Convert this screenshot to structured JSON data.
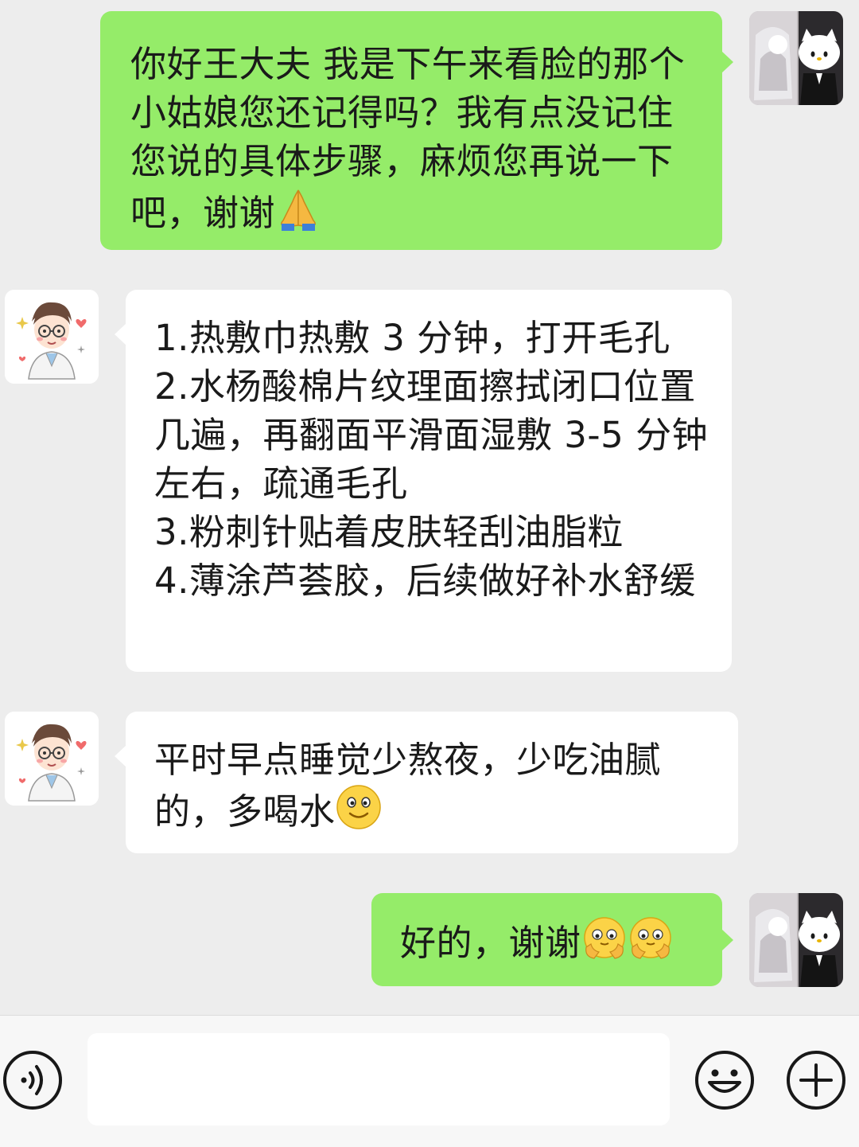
{
  "messages": [
    {
      "sender": "me",
      "text": "你好王大夫 我是下午来看脸的那个小姑娘您还记得吗？我有点没记住您说的具体步骤，麻烦您再说一下吧，谢谢",
      "emoji": "folded-hands"
    },
    {
      "sender": "doctor",
      "text": "1.热敷巾热敷 3 分钟，打开毛孔\n2.水杨酸棉片纹理面擦拭闭口位置几遍，再翻面平滑面湿敷 3-5 分钟左右，疏通毛孔\n3.粉刺针贴着皮肤轻刮油脂粒\n4.薄涂芦荟胶，后续做好补水舒缓"
    },
    {
      "sender": "doctor",
      "text": "平时早点睡觉少熬夜，少吃油腻的，多喝水",
      "emoji": "smile"
    },
    {
      "sender": "me",
      "text": "好的，谢谢",
      "emoji": "heart-hands x2"
    }
  ],
  "input_bar": {
    "value": "",
    "placeholder": "",
    "icons": [
      "voice-icon",
      "emoji-icon",
      "plus-icon"
    ]
  },
  "colors": {
    "background": "#ededed",
    "outgoing_bubble": "#95ec69",
    "incoming_bubble": "#ffffff",
    "input_bar": "#f7f7f7"
  }
}
